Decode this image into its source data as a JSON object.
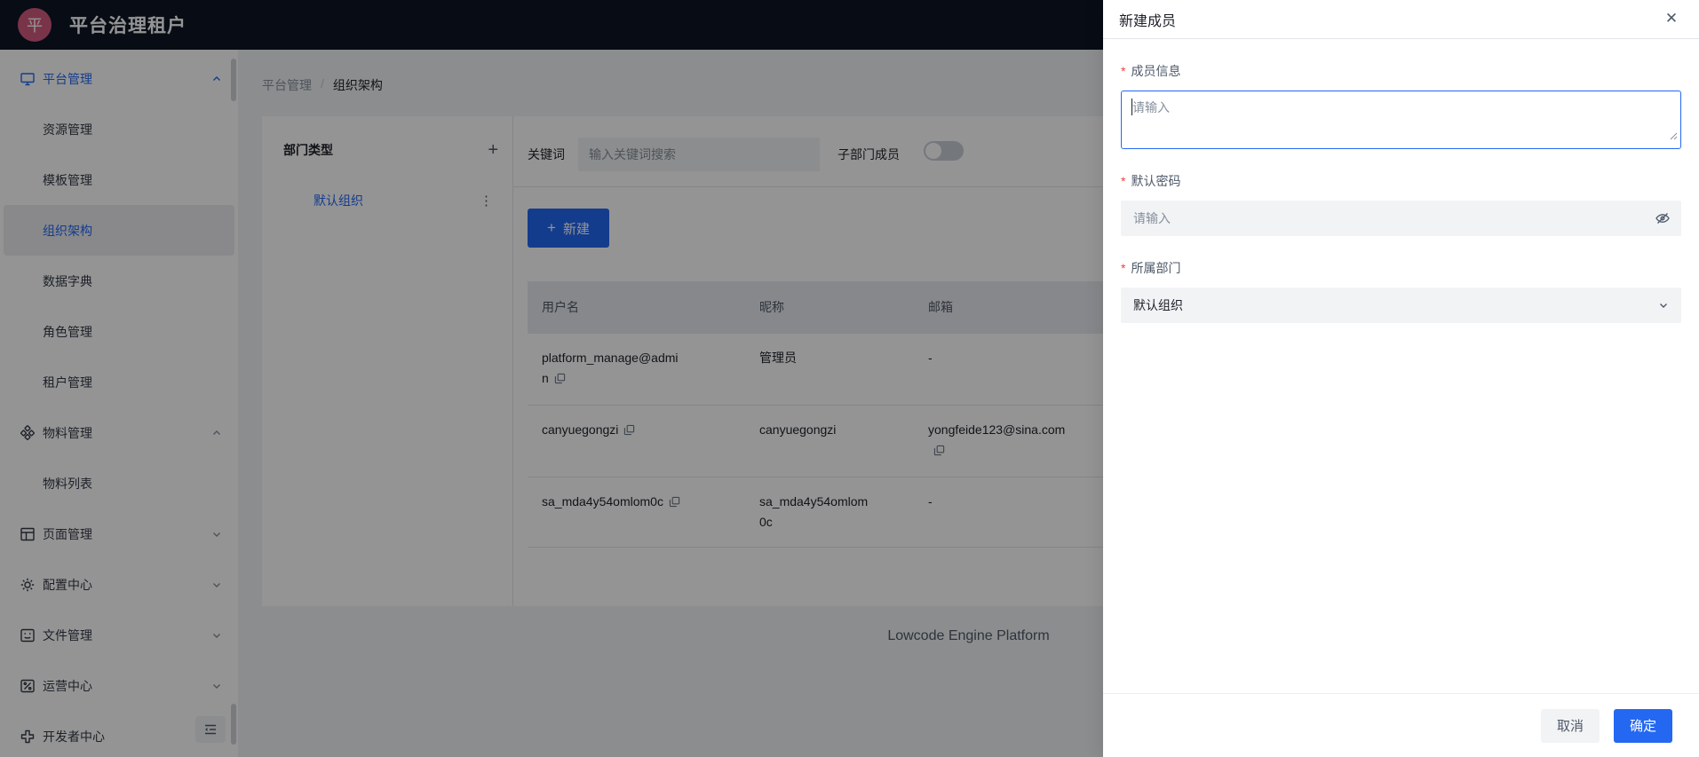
{
  "header": {
    "logo_text": "平",
    "title": "平台治理租户"
  },
  "sidebar": {
    "items": [
      {
        "label": "平台管理",
        "type": "parent",
        "icon": "monitor-icon",
        "state": "expanded",
        "active": true
      },
      {
        "label": "资源管理",
        "type": "sub"
      },
      {
        "label": "模板管理",
        "type": "sub"
      },
      {
        "label": "组织架构",
        "type": "sub",
        "selected": true
      },
      {
        "label": "数据字典",
        "type": "sub"
      },
      {
        "label": "角色管理",
        "type": "sub"
      },
      {
        "label": "租户管理",
        "type": "sub"
      },
      {
        "label": "物料管理",
        "type": "parent",
        "icon": "components-icon",
        "state": "expanded"
      },
      {
        "label": "物料列表",
        "type": "sub"
      },
      {
        "label": "页面管理",
        "type": "parent",
        "icon": "layout-icon",
        "state": "collapsed"
      },
      {
        "label": "配置中心",
        "type": "parent",
        "icon": "gear-icon",
        "state": "collapsed"
      },
      {
        "label": "文件管理",
        "type": "parent",
        "icon": "file-icon",
        "state": "collapsed"
      },
      {
        "label": "运营中心",
        "type": "parent",
        "icon": "operations-icon",
        "state": "collapsed"
      },
      {
        "label": "开发者中心",
        "type": "parent",
        "icon": "developer-icon",
        "state": "collapsed"
      }
    ]
  },
  "breadcrumb": {
    "items": [
      "平台管理",
      "组织架构"
    ],
    "separator": "/"
  },
  "dept_panel": {
    "title": "部门类型",
    "add_label": "+",
    "more_label": "⋮",
    "tree": [
      {
        "label": "默认组织"
      }
    ]
  },
  "toolbar": {
    "keyword_label": "关键词",
    "search_placeholder": "输入关键词搜索",
    "search_value": "",
    "toggle_label": "子部门成员",
    "toggle_state": "off",
    "create_plus": "+",
    "create_label": "新建"
  },
  "table": {
    "columns": [
      "用户名",
      "昵称",
      "邮箱"
    ],
    "rows": [
      {
        "cells": [
          {
            "text": "platform_manage@admin",
            "copy": true
          },
          {
            "text": "管理员",
            "copy": false
          },
          {
            "text": "-",
            "copy": false
          }
        ]
      },
      {
        "cells": [
          {
            "text": "canyuegongzi",
            "copy": true
          },
          {
            "text": "canyuegongzi",
            "copy": false
          },
          {
            "text": "yongfeide123@sina.com",
            "copy": true
          }
        ]
      },
      {
        "cells": [
          {
            "text": "sa_mda4y54omlom0c",
            "copy": true
          },
          {
            "text": "sa_mda4y54omlom0c",
            "copy": false
          },
          {
            "text": "-",
            "copy": false
          }
        ]
      }
    ]
  },
  "footer": {
    "text": "Lowcode Engine Platform"
  },
  "drawer": {
    "title": "新建成员",
    "close_label": "✕",
    "fields": [
      {
        "label": "成员信息",
        "required": true,
        "type": "textarea",
        "placeholder": "请输入",
        "value": "",
        "focused": true
      },
      {
        "label": "默认密码",
        "required": true,
        "type": "password",
        "placeholder": "请输入",
        "value": ""
      },
      {
        "label": "所属部门",
        "required": true,
        "type": "select",
        "value": "默认组织"
      }
    ],
    "cancel_label": "取消",
    "ok_label": "确定"
  },
  "colors": {
    "primary_blue": "#2468f2",
    "header_bg": "#0d1625",
    "logo_pink": "#d25b7e",
    "required_red": "#f53f3f",
    "mask": "rgba(0,0,0,0.42)",
    "input_bg": "#f2f3f5",
    "table_header_bg": "#e9ebef"
  }
}
